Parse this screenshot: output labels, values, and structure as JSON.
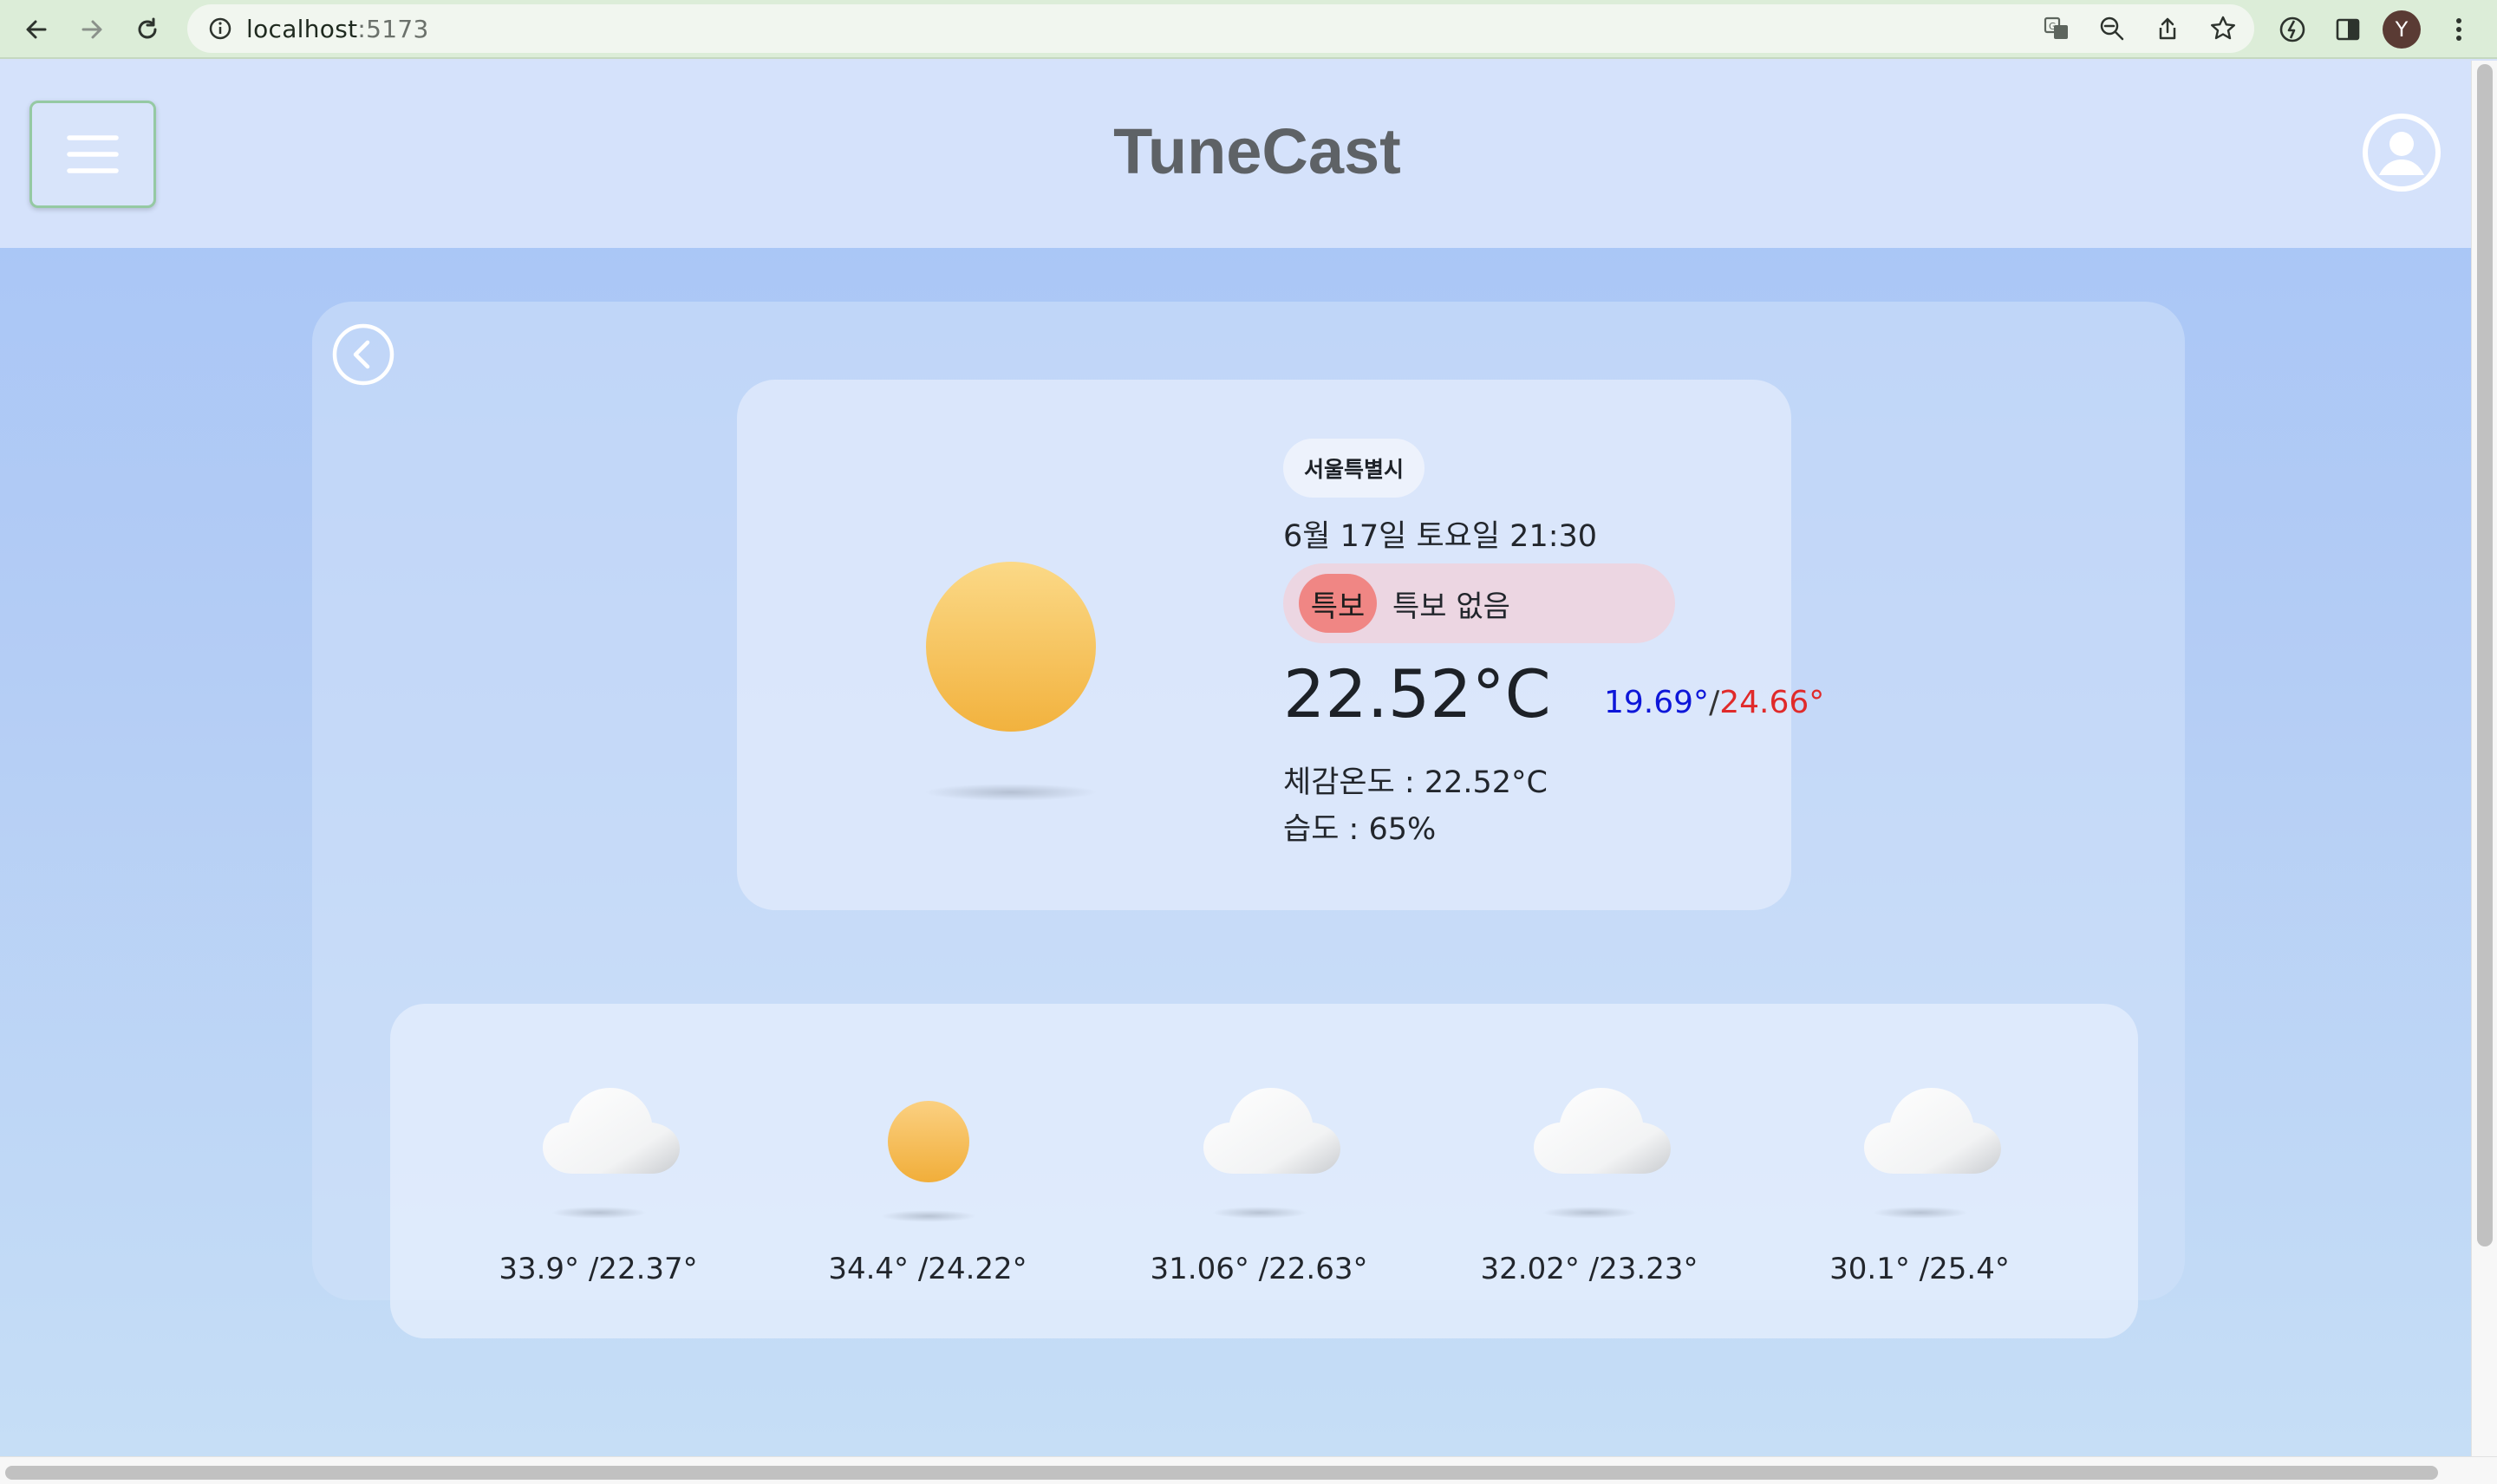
{
  "browser": {
    "url_host": "localhost",
    "url_port": ":5173",
    "icons": [
      "back-arrow-icon",
      "forward-arrow-icon",
      "reload-icon",
      "site-info-icon",
      "translate-icon",
      "zoom-out-icon",
      "share-icon",
      "bookmark-star-icon",
      "extension-icon",
      "side-panel-icon",
      "kebab-menu-icon"
    ],
    "profile_initial": "Y"
  },
  "header": {
    "title": "TuneCast",
    "menu_icon": "hamburger-icon",
    "user_icon": "user-circle-icon"
  },
  "current": {
    "city": "서울특별시",
    "datetime": "6월 17일 토요일 21:30",
    "alert_tag": "특보",
    "alert_text": "특보 없음",
    "temp": "22.52°C",
    "temp_min": "19.69°",
    "separator": "/",
    "temp_max": "24.66°",
    "feels_like": "체감온도 : 22.52°C",
    "humidity": "습도 : 65%",
    "icon": "sun-icon"
  },
  "forecast": [
    {
      "icon": "cloud-icon",
      "temps": "33.9° /22.37°"
    },
    {
      "icon": "sun-icon",
      "temps": "34.4° /24.22°"
    },
    {
      "icon": "cloud-icon",
      "temps": "31.06° /22.63°"
    },
    {
      "icon": "cloud-icon",
      "temps": "32.02° /23.23°"
    },
    {
      "icon": "cloud-icon",
      "temps": "30.1° /25.4°"
    }
  ],
  "colors": {
    "min_temp": "#0d16d9",
    "max_temp": "#e02a2a",
    "alert_tag": "#f08684",
    "sun": "#f2b23e"
  }
}
